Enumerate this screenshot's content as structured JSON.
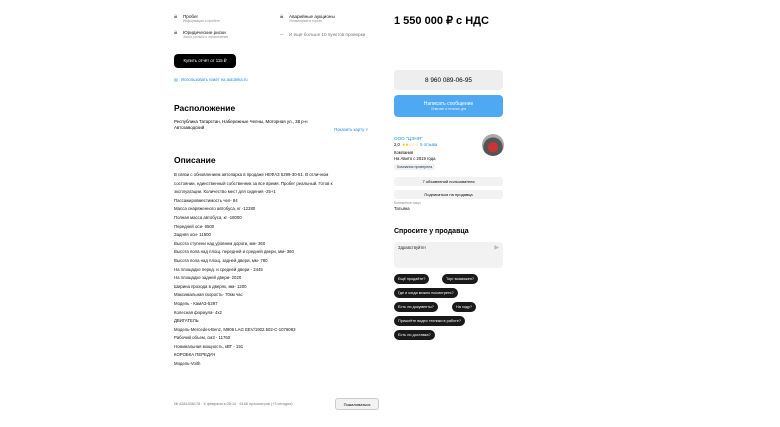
{
  "top_cut_text": "",
  "checks": [
    {
      "title": "Пробег",
      "sub": "Информация о пробеге"
    },
    {
      "title": "Аварийные аукционы",
      "sub": "Упоминание в торгах"
    },
    {
      "title": "Юридические риски",
      "sub": "Залог, розыск и ограничения"
    },
    {
      "title": "И ещё больше 10 пунктов проверки",
      "sub": ""
    }
  ],
  "buy_report_label": "Купить отчёт от 115 ₽",
  "use_package_link": "Использовать пакет на autoteka.ru",
  "location": {
    "title": "Расположение",
    "address": "Республика Татарстан, Набережные Челны, Моторная ул., 38 р-н Автозаводский",
    "map_link": "Показать карту ˅"
  },
  "description": {
    "title": "Описание",
    "lines": [
      "В связи с обновлением автопарка в продаже НЕФАЗ 5299-30-51. В отличном",
      "состоянии, единственный собственник за все время. Пробег реальный. Готов к",
      "эксплуатации. Количество мест для сидения -25+1",
      "Пассажировместимость чел- 84",
      "Масса снаряженного автобуса, кг -12280",
      "Полная масса автобуса, кг -18000",
      "Передней оси- 6500",
      "Задняя оси- 11500",
      "Высота ступени над уровнем дороги, мм- 360",
      "Высота пола над площ. передней и средней двери, мм- 360",
      "Высота пола над площ. задней двери, мм- 780",
      "На площадке перед. и средней двери - 2445",
      "На площадке задней двери- 2020",
      "Ширина прохода в дверях, мм- 1200",
      "Максимальная скорость- 70км час",
      "Модель - КамАЗ-5297",
      "Колесная формула- 4х2",
      "ДВИГАТЕЛЬ",
      "Модель-Mercedes-Benz, M906 LAG EEV/1902.502-C-1076083",
      "Рабочий объем, см3 - 11760",
      "Номинальная мощность, кВТ - 191",
      "КОРОБКА ПЕРЕДАЧ",
      "Модель-Voith"
    ]
  },
  "footer": {
    "meta": "№ 4284336178 · 6 февраля в 08:14 · 5166 просмотров (+3 сегодня)",
    "complain_label": "Пожаловаться"
  },
  "price": "1 550 000 ₽ с НДС",
  "phone_label": "8 960 089-06-95",
  "message_button": {
    "label": "Написать сообщение",
    "sub": "Отвечает в течение дня"
  },
  "seller": {
    "name": "ООО \"ЦЭНЯ\"",
    "rating_value": "2,0",
    "stars": "★★☆☆☆",
    "reviews": "5 отзыва",
    "type": "Компания",
    "since": "На Авито с 2019 года",
    "badge": "Компания проверена",
    "ads_button": "7 объявлений пользователя",
    "subscribe_button": "Подписаться на продавца",
    "contact_label": "Контактное лицо",
    "contact_name": "Татьяна"
  },
  "ask": {
    "title": "Спросите у продавца",
    "message": "Здравствуйте!",
    "chips": [
      "Ещё продаёте?",
      "Торг возможен?",
      "Где и когда можно посмотреть?",
      "Есть ли документы?",
      "На ходу?",
      "Пришлёте видео техники в работе?",
      "Есть ли доставка?"
    ]
  }
}
